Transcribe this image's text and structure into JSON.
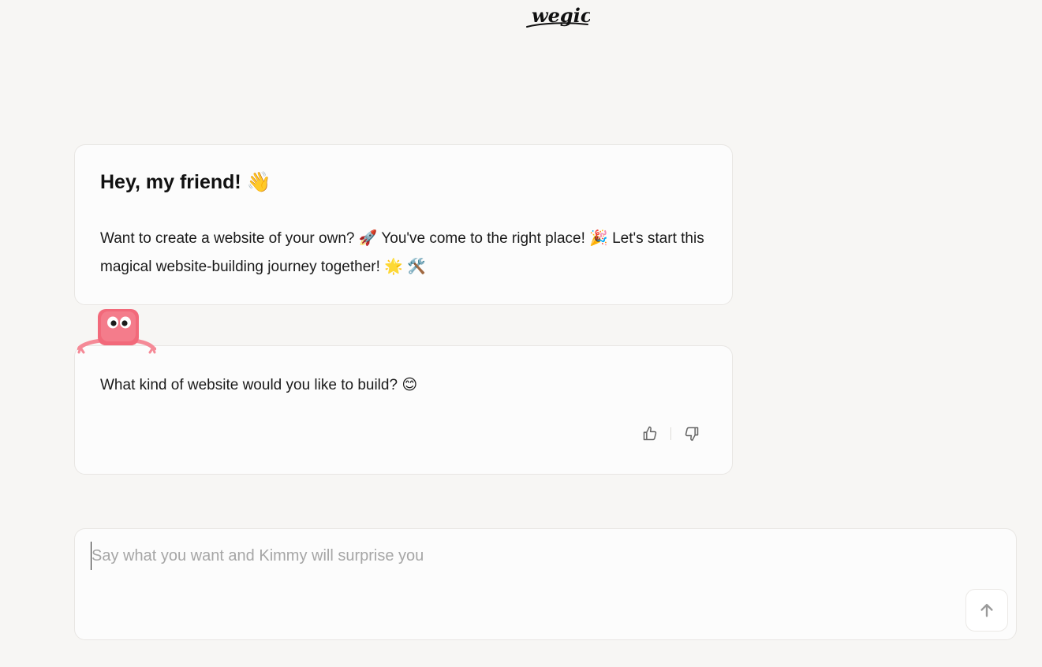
{
  "logo": {
    "text": "wegic"
  },
  "welcome": {
    "title": "Hey, my friend! 👋",
    "body": "Want to create a website of your own? 🚀 You've come to the right place! 🎉 Let's start this magical website-building journey together! 🌟 🛠️"
  },
  "question": {
    "text": "What kind of website would you like to build? 😊",
    "feedback": {
      "like_icon": "thumbs-up-icon",
      "dislike_icon": "thumbs-down-icon"
    }
  },
  "mascot": {
    "icon": "kimmy-mascot-icon"
  },
  "composer": {
    "placeholder": "Say what you want and Kimmy will surprise you",
    "value": "",
    "send_icon": "arrow-up-icon"
  },
  "colors": {
    "background": "#f7f6f4",
    "card": "#fcfcfc",
    "mascot": "#f2697a",
    "icon_gray": "#6b6b6b"
  }
}
